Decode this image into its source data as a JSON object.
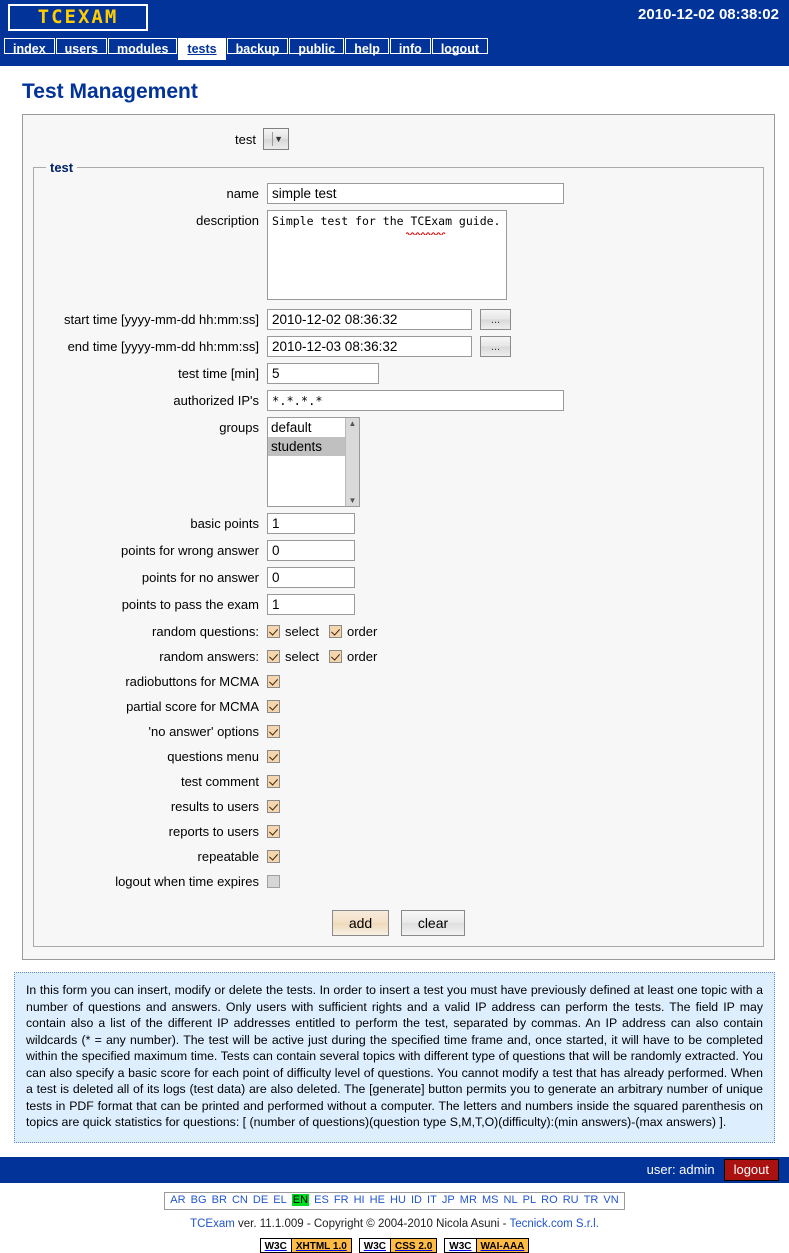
{
  "header": {
    "logo_text": "TCEXAM",
    "datetime": "2010-12-02 08:38:02"
  },
  "nav": {
    "items": [
      {
        "label": "index",
        "active": false
      },
      {
        "label": "users",
        "active": false
      },
      {
        "label": "modules",
        "active": false
      },
      {
        "label": "tests",
        "active": true
      },
      {
        "label": "backup",
        "active": false
      },
      {
        "label": "public",
        "active": false
      },
      {
        "label": "help",
        "active": false
      },
      {
        "label": "info",
        "active": false
      },
      {
        "label": "logout",
        "active": false
      }
    ]
  },
  "page": {
    "title": "Test Management"
  },
  "form": {
    "test_select_label": "test",
    "test_select_value": "",
    "fieldset_legend": "test",
    "fields": {
      "name_label": "name",
      "name_value": "simple test",
      "description_label": "description",
      "description_value": "Simple test for the TCExam guide.",
      "start_time_label": "start time [yyyy-mm-dd hh:mm:ss]",
      "start_time_value": "2010-12-02 08:36:32",
      "end_time_label": "end time [yyyy-mm-dd hh:mm:ss]",
      "end_time_value": "2010-12-03 08:36:32",
      "picker_button_label": "...",
      "test_time_label": "test time [min]",
      "test_time_value": "5",
      "authorized_ips_label": "authorized IP's",
      "authorized_ips_value": "*.*.*.*",
      "groups_label": "groups",
      "groups_options": [
        "default",
        "students"
      ],
      "groups_selected": "students",
      "basic_points_label": "basic points",
      "basic_points_value": "1",
      "wrong_answer_points_label": "points for wrong answer",
      "wrong_answer_points_value": "0",
      "no_answer_points_label": "points for no answer",
      "no_answer_points_value": "0",
      "pass_points_label": "points to pass the exam",
      "pass_points_value": "1",
      "random_questions_label": "random questions:",
      "random_answers_label": "random answers:",
      "select_label": "select",
      "order_label": "order",
      "random_questions_select": true,
      "random_questions_order": true,
      "random_answers_select": true,
      "random_answers_order": true
    },
    "toggles": [
      {
        "label": "radiobuttons for MCMA",
        "checked": true
      },
      {
        "label": "partial score for MCMA",
        "checked": true
      },
      {
        "label": "'no answer' options",
        "checked": true
      },
      {
        "label": "questions menu",
        "checked": true
      },
      {
        "label": "test comment",
        "checked": true
      },
      {
        "label": "results to users",
        "checked": true
      },
      {
        "label": "reports to users",
        "checked": true
      },
      {
        "label": "repeatable",
        "checked": true
      },
      {
        "label": "logout when time expires",
        "checked": false
      }
    ],
    "buttons": {
      "add_label": "add",
      "clear_label": "clear"
    }
  },
  "help": {
    "text": "In this form you can insert, modify or delete the tests. In order to insert a test you must have previously defined at least one topic with a number of questions and answers. Only users with sufficient rights and a valid IP address can perform the tests. The field IP may contain also a list of the different IP addresses entitled to perform the test, separated by commas. An IP address can also contain wildcards (* = any number). The test will be active just during the specified time frame and, once started, it will have to be completed within the specified maximum time. Tests can contain several topics with different type of questions that will be randomly extracted. You can also specify a basic score for each point of difficulty level of questions. You cannot modify a test that has already performed. When a test is deleted all of its logs (test data) are also deleted. The [generate] button permits you to generate an arbitrary number of unique tests in PDF format that can be printed and performed without a computer. The letters and numbers inside the squared parenthesis on topics are quick statistics for questions: [ (number of questions)(question type S,M,T,O)(difficulty):(min answers)-(max answers) ]."
  },
  "footer": {
    "user_text": "user: admin",
    "logout_label": "logout",
    "languages": [
      "AR",
      "BG",
      "BR",
      "CN",
      "DE",
      "EL",
      "EN",
      "ES",
      "FR",
      "HI",
      "HE",
      "HU",
      "ID",
      "IT",
      "JP",
      "MR",
      "MS",
      "NL",
      "PL",
      "RO",
      "RU",
      "TR",
      "VN"
    ],
    "current_language": "EN",
    "copyright_app": "TCExam",
    "copyright_mid": " ver. 11.1.009 - Copyright © 2004-2010 Nicola Asuni - ",
    "copyright_link": "Tecnick.com S.r.l.",
    "badges": [
      {
        "left": "W3C",
        "right": "XHTML 1.0"
      },
      {
        "left": "W3C",
        "right": "CSS 2.0"
      },
      {
        "left": "W3C",
        "right": "WAI-AAA"
      }
    ]
  },
  "colors": {
    "brand_blue": "#013399",
    "logo_yellow": "#ffcc00",
    "help_bg": "#ddeeff",
    "logout_red": "#aa1111",
    "lang_current": "#00dd22",
    "badge_orange": "#ffbb44",
    "checkbox_on": "#f6d5ac"
  }
}
